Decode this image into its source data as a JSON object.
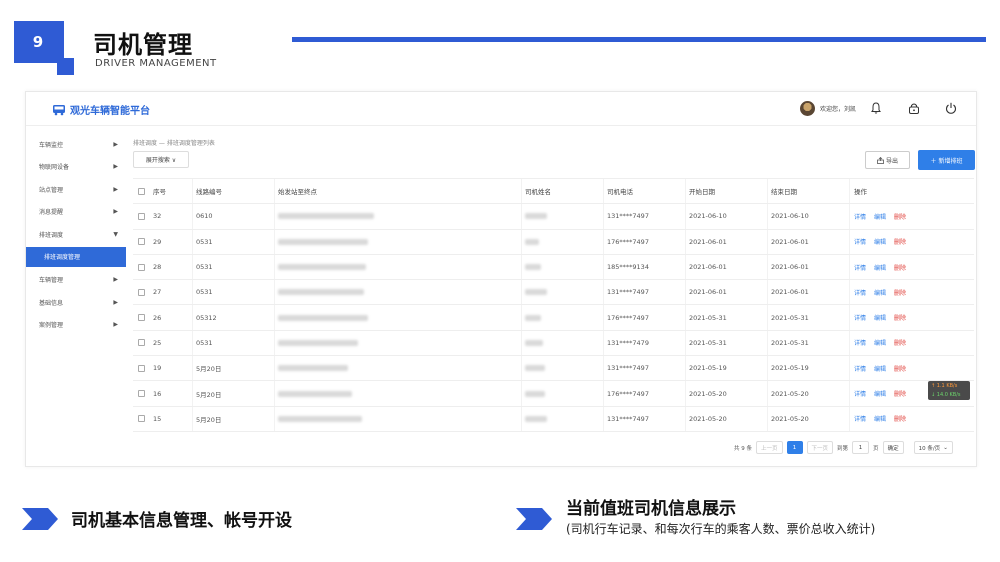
{
  "slide": {
    "number": "9",
    "title": "司机管理",
    "subtitle": "DRIVER MANAGEMENT",
    "accent_color": "#2f5bd4"
  },
  "app": {
    "brand": "观光车辆智能平台",
    "brand_icon": "bus-icon",
    "user_text": "欢迎您，刘凯",
    "top_icons": [
      "bell-icon",
      "lock-icon",
      "power-icon"
    ],
    "sidebar": [
      {
        "label": "车辆监控",
        "arrow": "▶"
      },
      {
        "label": "物联网设备",
        "arrow": "▶"
      },
      {
        "label": "站点管理",
        "arrow": "▶"
      },
      {
        "label": "消息提醒",
        "arrow": "▶"
      },
      {
        "label": "排班调度",
        "arrow": "▼"
      }
    ],
    "sidebar_active_sub": "排班调度管理",
    "sidebar_after": [
      {
        "label": "车辆管理",
        "arrow": "▶"
      },
      {
        "label": "基础信息",
        "arrow": "▶"
      },
      {
        "label": "案例管理",
        "arrow": "▶"
      }
    ],
    "breadcrumb": "排班调度  —  排班调度管理列表",
    "expand_button": "展开搜索 ∨",
    "export_button": "导出",
    "add_button": "新增排班",
    "table": {
      "headers": [
        "序号",
        "线路编号",
        "始发站至终点",
        "司机姓名",
        "司机电话",
        "开始日期",
        "结束日期",
        "操作"
      ],
      "rows": [
        {
          "idx": "32",
          "route": "0610",
          "stops": "",
          "stops_blur": 96,
          "name_blur": 22,
          "phone": "131****7497",
          "start": "2021-06-10",
          "end": "2021-06-10"
        },
        {
          "idx": "29",
          "route": "0531",
          "stops": "",
          "stops_blur": 90,
          "name_blur": 14,
          "phone": "176****7497",
          "start": "2021-06-01",
          "end": "2021-06-01"
        },
        {
          "idx": "28",
          "route": "0531",
          "stops": "",
          "stops_blur": 88,
          "name_blur": 16,
          "phone": "185****9134",
          "start": "2021-06-01",
          "end": "2021-06-01"
        },
        {
          "idx": "27",
          "route": "0531",
          "stops": "",
          "stops_blur": 86,
          "name_blur": 22,
          "phone": "131****7497",
          "start": "2021-06-01",
          "end": "2021-06-01"
        },
        {
          "idx": "26",
          "route": "05312",
          "stops": "",
          "stops_blur": 90,
          "name_blur": 16,
          "phone": "176****7497",
          "start": "2021-05-31",
          "end": "2021-05-31"
        },
        {
          "idx": "25",
          "route": "0531",
          "stops": "",
          "stops_blur": 80,
          "name_blur": 18,
          "phone": "131****7479",
          "start": "2021-05-31",
          "end": "2021-05-31"
        },
        {
          "idx": "19",
          "route": "5月20日",
          "stops": "",
          "stops_blur": 70,
          "name_blur": 20,
          "phone": "131****7497",
          "start": "2021-05-19",
          "end": "2021-05-19"
        },
        {
          "idx": "16",
          "route": "5月20日",
          "stops": "",
          "stops_blur": 74,
          "name_blur": 20,
          "phone": "176****7497",
          "start": "2021-05-20",
          "end": "2021-05-20"
        },
        {
          "idx": "15",
          "route": "5月20日",
          "stops": "",
          "stops_blur": 84,
          "name_blur": 22,
          "phone": "131****7497",
          "start": "2021-05-20",
          "end": "2021-05-20"
        }
      ],
      "ops": {
        "detail": "详情",
        "edit": "编辑",
        "delete": "删除"
      }
    },
    "speed": {
      "up": "↑ 1.1 KB/s",
      "down": "↓ 14.0 KB/s"
    },
    "pager": {
      "total": "共 9 条",
      "prev": "上一页",
      "current": "1",
      "next": "下一页",
      "goto": "到第",
      "page_input": "1",
      "page_unit": "页",
      "confirm": "确定",
      "size": "10 条/页"
    }
  },
  "captions": {
    "left": "司机基本信息管理、帐号开设",
    "right_title": "当前值班司机信息展示",
    "right_sub": "(司机行车记录、和每次行车的乘客人数、票价总收入统计)"
  }
}
